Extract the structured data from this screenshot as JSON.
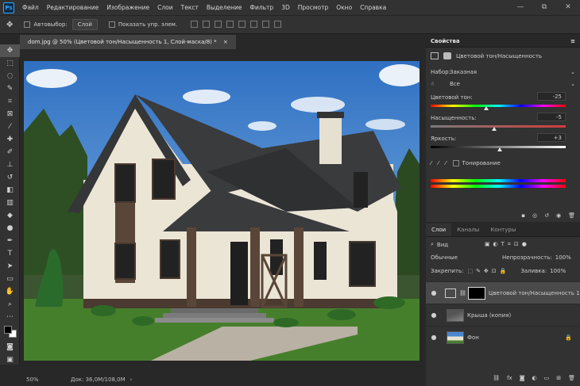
{
  "app": {
    "logo": "Ps"
  },
  "menu": [
    "Файл",
    "Редактирование",
    "Изображение",
    "Слои",
    "Текст",
    "Выделение",
    "Фильтр",
    "3D",
    "Просмотр",
    "Окно",
    "Справка"
  ],
  "window_controls": {
    "minimize": "—",
    "restore": "⧉",
    "close": "✕"
  },
  "options": {
    "autoselect_label": "Автовыбор:",
    "autoselect_value": "Слой",
    "show_controls_label": "Показать упр. элем."
  },
  "document_tab": {
    "title": "dom.jpg @ 50% (Цветовой тон/Насыщенность 1, Слой-маска/8) *",
    "close": "×"
  },
  "status": {
    "zoom": "50%",
    "doc_size": "Док: 36,0M/108,0M"
  },
  "properties": {
    "panel_title": "Свойства",
    "adjustment_title": "Цветовой тон/Насыщенность",
    "preset_label": "Набор:",
    "preset_value": "Заказная",
    "channel_value": "Все",
    "hue_label": "Цветовой тон:",
    "hue_value": "-25",
    "hue_fraction": 0.41,
    "saturation_label": "Насыщенность:",
    "saturation_value": "-5",
    "saturation_fraction": 0.47,
    "lightness_label": "Яркость:",
    "lightness_value": "+3",
    "lightness_fraction": 0.51,
    "colorize_label": "Тонирование"
  },
  "layers_panel": {
    "tabs": [
      "Слои",
      "Каналы",
      "Контуры"
    ],
    "filter_value": "Вид",
    "blend_mode": "Обычные",
    "opacity_label": "Непрозрачность:",
    "opacity_value": "100%",
    "lock_label": "Закрепить:",
    "fill_label": "Заливка:",
    "fill_value": "100%",
    "layers": [
      {
        "name": "Цветовой тон/Насыщенность 1",
        "selected": true
      },
      {
        "name": "Крыша (копия)",
        "selected": false
      },
      {
        "name": "Фон",
        "selected": false
      }
    ]
  },
  "colors": {
    "accent": "#31a8ff",
    "selected_layer": "#4a4a4a",
    "sky": "#3a7cc8",
    "wall": "#ebe5d6",
    "roof": "#353638",
    "grass": "#3e7a2a"
  }
}
